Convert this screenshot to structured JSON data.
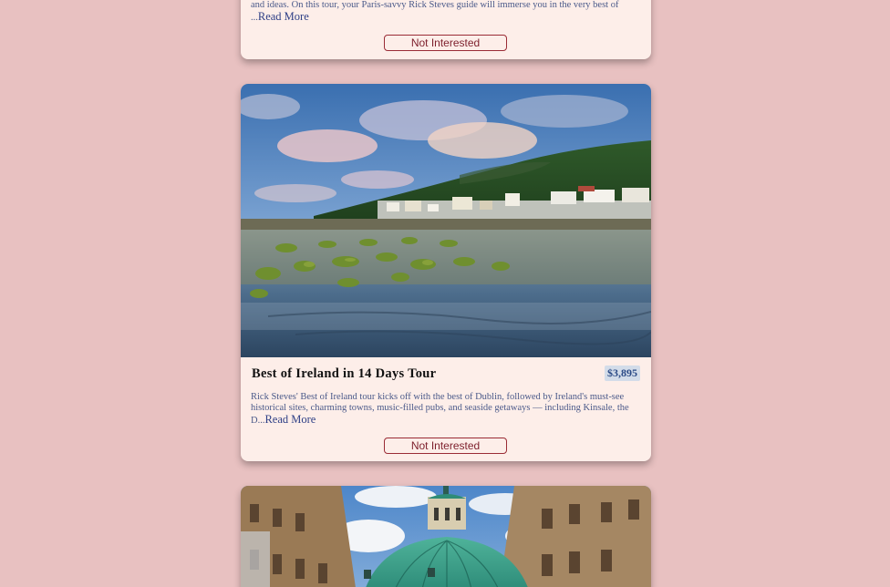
{
  "tours": [
    {
      "description_tail": "and ideas. On this tour, your Paris-savvy Rick Steves guide will immerse you in the very best of ...",
      "read_more": "Read More",
      "not_interested": "Not Interested"
    },
    {
      "title": "Best of Ireland in 14 Days Tour",
      "price": "$3,895",
      "description": "Rick Steves' Best of Ireland tour kicks off with the best of Dublin, followed by Ireland's must-see historical sites, charming towns, music-filled pubs, and seaside getaways — including Kinsale, the D...",
      "read_more": "Read More",
      "not_interested": "Not Interested"
    }
  ],
  "colors": {
    "page_background": "#e8c1c1",
    "card_background": "#fdeee9",
    "button_border": "#9a2b35",
    "price_badge_background": "#d3dce9",
    "link_color": "#2e3f86"
  }
}
